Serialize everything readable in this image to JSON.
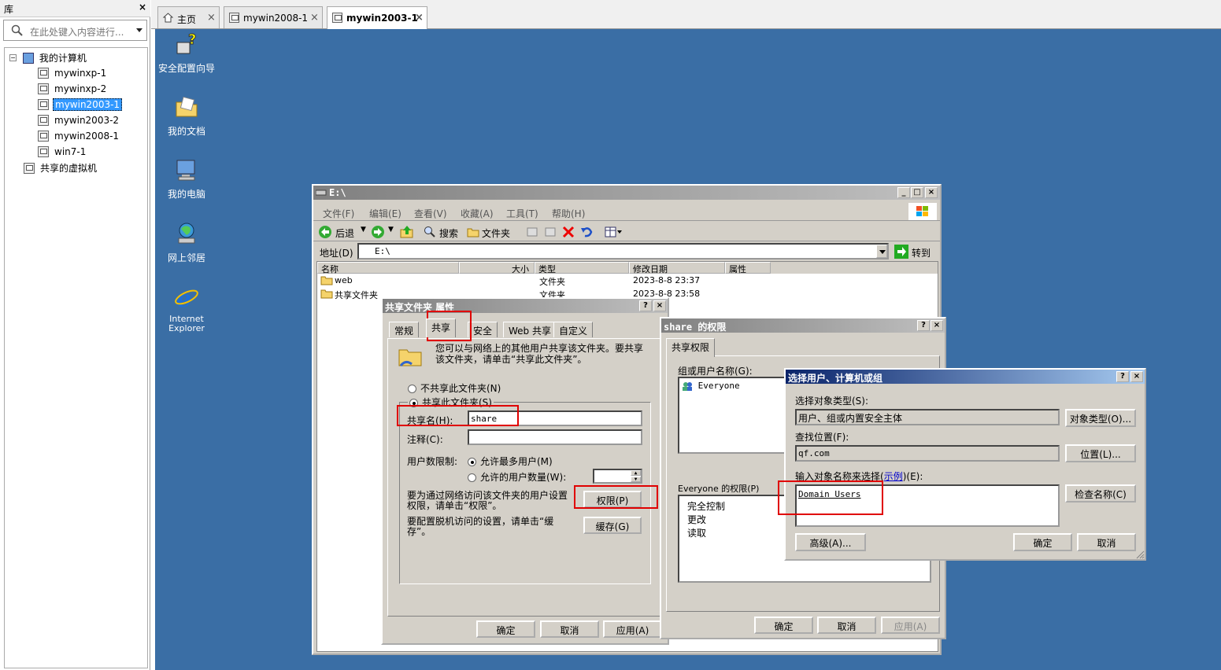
{
  "library": {
    "title": "库",
    "close": "×",
    "search_placeholder": "在此处键入内容进行...",
    "tree": [
      {
        "label": "我的计算机"
      },
      {
        "label": "mywinxp-1"
      },
      {
        "label": "mywinxp-2"
      },
      {
        "label": "mywin2003-1"
      },
      {
        "label": "mywin2003-2"
      },
      {
        "label": "mywin2008-1"
      },
      {
        "label": "win7-1"
      },
      {
        "label": "共享的虚拟机"
      }
    ]
  },
  "tabs": [
    {
      "label": "主页"
    },
    {
      "label": "mywin2008-1"
    },
    {
      "label": "mywin2003-1"
    }
  ],
  "desktop": {
    "icons": [
      {
        "label": "安全配置向导"
      },
      {
        "label": "我的文档"
      },
      {
        "label": "我的电脑"
      },
      {
        "label": "网上邻居"
      },
      {
        "label": "Internet Explorer"
      }
    ]
  },
  "explorer": {
    "title": "E:\\",
    "menu": [
      "文件(F)",
      "编辑(E)",
      "查看(V)",
      "收藏(A)",
      "工具(T)",
      "帮助(H)"
    ],
    "toolbar": {
      "back": "后退",
      "search": "搜索",
      "folders": "文件夹"
    },
    "address_label": "地址(D)",
    "address_value": "E:\\",
    "go": "转到",
    "columns": [
      "名称",
      "大小",
      "类型",
      "修改日期",
      "属性"
    ],
    "rows": [
      {
        "name": "web",
        "type": "文件夹",
        "date": "2023-8-8 23:37"
      },
      {
        "name": "共享文件夹",
        "type": "文件夹",
        "date": "2023-8-8 23:58"
      }
    ]
  },
  "props": {
    "title": "共享文件夹 属性",
    "tabs": [
      "常规",
      "共享",
      "安全",
      "Web 共享",
      "自定义"
    ],
    "info": "您可以与网络上的其他用户共享该文件夹。要共享该文件夹，请单击“共享此文件夹”。",
    "no_share": "不共享此文件夹(N)",
    "share": "共享此文件夹(S)",
    "share_name_label": "共享名(H):",
    "share_name_value": "share",
    "comment_label": "注释(C):",
    "user_limit_label": "用户数限制:",
    "max_users": "允许最多用户(M)",
    "allowed_users": "允许的用户数量(W):",
    "perm_text": "要为通过网络访问该文件夹的用户设置权限，请单击“权限”。",
    "perm_btn": "权限(P)",
    "cache_text": "要配置脱机访问的设置，请单击“缓存”。",
    "cache_btn": "缓存(G)",
    "ok": "确定",
    "cancel": "取消",
    "apply": "应用(A)"
  },
  "perm": {
    "title": "share 的权限",
    "tab": "共享权限",
    "group_label": "组或用户名称(G):",
    "group_item": "Everyone",
    "perm_label": "Everyone 的权限(P)",
    "perms": [
      "完全控制",
      "更改",
      "读取"
    ],
    "ok": "确定",
    "cancel": "取消",
    "apply": "应用(A)"
  },
  "select": {
    "title": "选择用户、计算机或组",
    "obj_type_label": "选择对象类型(S):",
    "obj_type_value": "用户、组或内置安全主体",
    "obj_type_btn": "对象类型(O)...",
    "loc_label": "查找位置(F):",
    "loc_value": "qf.com",
    "loc_btn": "位置(L)...",
    "name_label_a": "输入对象名称来选择(",
    "name_link": "示例",
    "name_label_b": ")(E):",
    "name_value": "Domain Users",
    "check_btn": "检查名称(C)",
    "adv_btn": "高级(A)...",
    "ok": "确定",
    "cancel": "取消"
  }
}
